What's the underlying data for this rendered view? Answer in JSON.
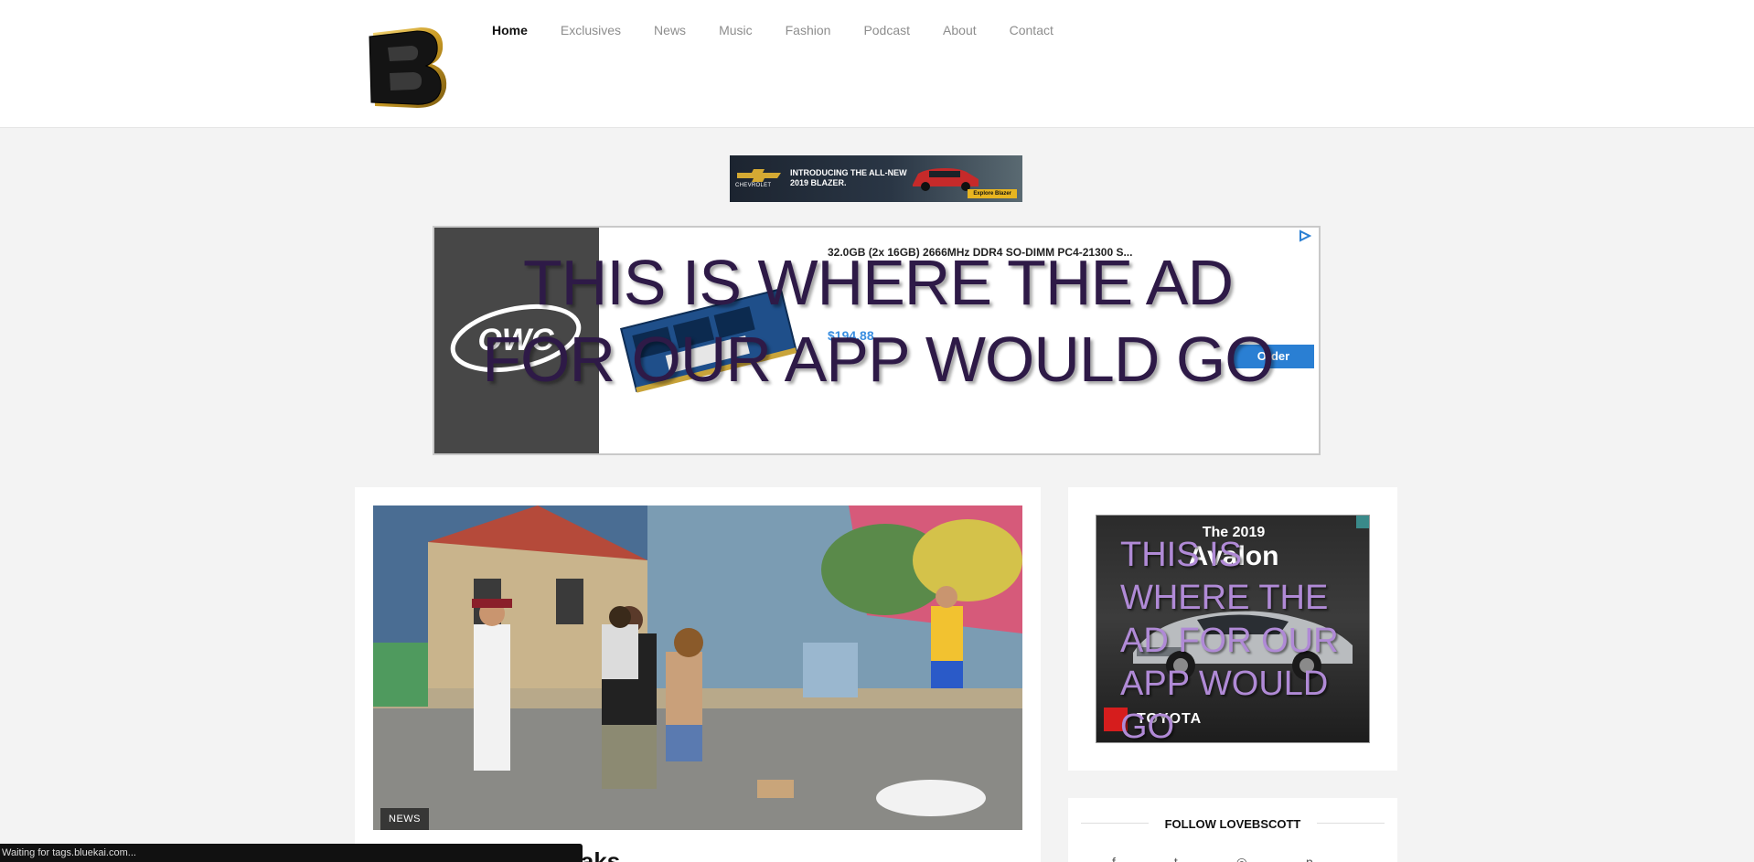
{
  "header": {
    "logo_alt": "B",
    "nav": [
      {
        "label": "Home",
        "active": true
      },
      {
        "label": "Exclusives",
        "active": false
      },
      {
        "label": "News",
        "active": false
      },
      {
        "label": "Music",
        "active": false
      },
      {
        "label": "Fashion",
        "active": false
      },
      {
        "label": "Podcast",
        "active": false
      },
      {
        "label": "About",
        "active": false
      },
      {
        "label": "Contact",
        "active": false
      }
    ]
  },
  "banner_ad": {
    "brand": "CHEVROLET",
    "headline": "INTRODUCING THE ALL-NEW 2019 BLAZER.",
    "cta": "Explore Blazer"
  },
  "large_ad": {
    "product_title": "32.0GB (2x 16GB) 2666MHz DDR4 SO-DIMM PC4-21300 S...",
    "price": "$194.88",
    "order_label": "Order",
    "brand": "OWC",
    "overlay_text": "THIS IS WHERE THE AD FOR OUR APP WOULD GO"
  },
  "article": {
    "category": "NEWS",
    "title_partial": "t Family Brawl Breaks"
  },
  "sidebar_ad": {
    "year": "The 2019",
    "model": "Avalon",
    "brand": "TOYOTA",
    "overlay_text": "THIS IS WHERE THE AD FOR OUR APP WOULD GO"
  },
  "follow": {
    "title": "FOLLOW LOVEBSCOTT",
    "icons": [
      "facebook-icon",
      "twitter-icon",
      "instagram-icon",
      "pinterest-icon"
    ]
  },
  "status_bar": {
    "text": "Waiting for tags.bluekai.com..."
  },
  "colors": {
    "page_bg": "#f3f3f3",
    "overlay_dark": "#2e1a47",
    "overlay_light": "#b08ad6",
    "order_button": "#2a7fd3"
  }
}
